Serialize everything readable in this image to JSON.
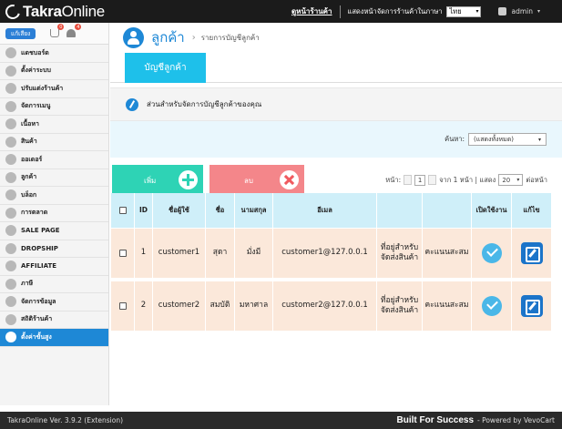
{
  "topbar": {
    "logo_bold": "Takra",
    "logo_thin": "Online",
    "home_link": "ดูหน้าร้านค้า",
    "lang_label": "แสดงหน้าจัดการร้านค้าในภาษา",
    "lang_value": "ไทย",
    "user": "admin"
  },
  "sidebar": {
    "shop_button": "แก้เสียง",
    "cart_count": "0",
    "bell_count": "4",
    "items": [
      {
        "label": "แดชบอร์ด"
      },
      {
        "label": "ตั้งค่าระบบ"
      },
      {
        "label": "ปรับแต่งร้านค้า"
      },
      {
        "label": "จัดการเมนู"
      },
      {
        "label": "เนื้อหา"
      },
      {
        "label": "สินค้า"
      },
      {
        "label": "ออเดอร์"
      },
      {
        "label": "ลูกค้า"
      },
      {
        "label": "บล็อก"
      },
      {
        "label": "การตลาด"
      },
      {
        "label": "SALE PAGE"
      },
      {
        "label": "DROPSHIP"
      },
      {
        "label": "AFFILIATE"
      },
      {
        "label": "ภาษี"
      },
      {
        "label": "จัดการข้อมูล"
      },
      {
        "label": "สถิติร้านค้า"
      },
      {
        "label": "ตั้งค่าขั้นสูง"
      }
    ]
  },
  "page": {
    "title": "ลูกค้า",
    "breadcrumb": "รายการบัญชีลูกค้า",
    "tab": "บัญชีลูกค้า",
    "info": "ส่วนสำหรับจัดการบัญชีลูกค้าของคุณ",
    "search_label": "ค้นหา:",
    "search_value": "(แสดงทั้งหมด)",
    "add_button": "เพิ่ม",
    "delete_button": "ลบ",
    "pager": {
      "page_label": "หน้า:",
      "page": "1",
      "of_text": "จาก 1 หน้า | แสดง",
      "per_page": "20",
      "per_page_suffix": "ต่อหน้า"
    }
  },
  "table": {
    "headers": [
      "ID",
      "ชื่อผู้ใช้",
      "ชื่อ",
      "นามสกุล",
      "อีเมล",
      "",
      "",
      "เปิดใช้งาน",
      "แก้ไข"
    ],
    "rows": [
      {
        "id": "1",
        "username": "customer1",
        "first": "สุดา",
        "last": "มั่งมี",
        "email": "customer1@127.0.0.1",
        "address": "ที่อยู่สำหรับจัดส่งสินค้า",
        "points": "คะแนนสะสม"
      },
      {
        "id": "2",
        "username": "customer2",
        "first": "สมบัติ",
        "last": "มหาศาล",
        "email": "customer2@127.0.0.1",
        "address": "ที่อยู่สำหรับจัดส่งสินค้า",
        "points": "คะแนนสะสม"
      }
    ]
  },
  "footer": {
    "version": "TakraOnline Ver. 3.9.2 (Extension)",
    "slogan": "Built For Success",
    "powered": "- Powered by VevoCart"
  }
}
